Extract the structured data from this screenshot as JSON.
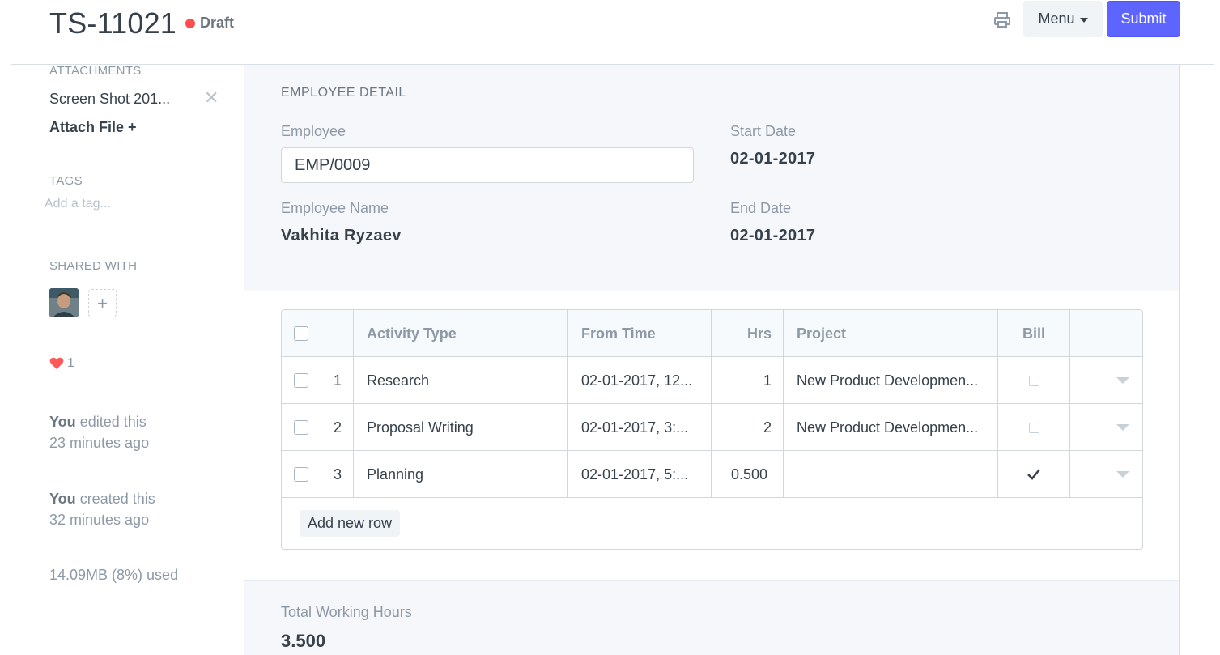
{
  "header": {
    "title": "TS-11021",
    "status": "Draft",
    "menu_label": "Menu",
    "submit_label": "Submit"
  },
  "sidebar": {
    "attachments_label": "ATTACHMENTS",
    "attachment_name": "Screen Shot 201...",
    "attach_file_label": "Attach File +",
    "tags_label": "TAGS",
    "tag_placeholder": "Add a tag...",
    "shared_with_label": "SHARED WITH",
    "likes_count": "1",
    "timeline": [
      {
        "who": "You",
        "action": "edited this",
        "when": "23 minutes ago"
      },
      {
        "who": "You",
        "action": "created this",
        "when": "32 minutes ago"
      }
    ],
    "usage": "14.09MB (8%) used"
  },
  "employee_detail": {
    "section_title": "EMPLOYEE DETAIL",
    "employee_label": "Employee",
    "employee_value": "EMP/0009",
    "employee_name_label": "Employee Name",
    "employee_name_value": "Vakhita Ryzaev",
    "start_date_label": "Start Date",
    "start_date_value": "02-01-2017",
    "end_date_label": "End Date",
    "end_date_value": "02-01-2017"
  },
  "time_logs": {
    "columns": {
      "activity_type": "Activity Type",
      "from_time": "From Time",
      "hrs": "Hrs",
      "project": "Project",
      "bill": "Bill"
    },
    "rows": [
      {
        "idx": "1",
        "activity_type": "Research",
        "from_time": "02-01-2017, 12...",
        "hrs": "1",
        "project": "New Product Developmen...",
        "billable": false
      },
      {
        "idx": "2",
        "activity_type": "Proposal Writing",
        "from_time": "02-01-2017, 3:...",
        "hrs": "2",
        "project": "New Product Developmen...",
        "billable": false
      },
      {
        "idx": "3",
        "activity_type": "Planning",
        "from_time": "02-01-2017, 5:...",
        "hrs": "0.500",
        "project": "",
        "billable": true
      }
    ],
    "add_row_label": "Add new row"
  },
  "totals": {
    "total_hours_label": "Total Working Hours",
    "total_hours_value": "3.500"
  }
}
